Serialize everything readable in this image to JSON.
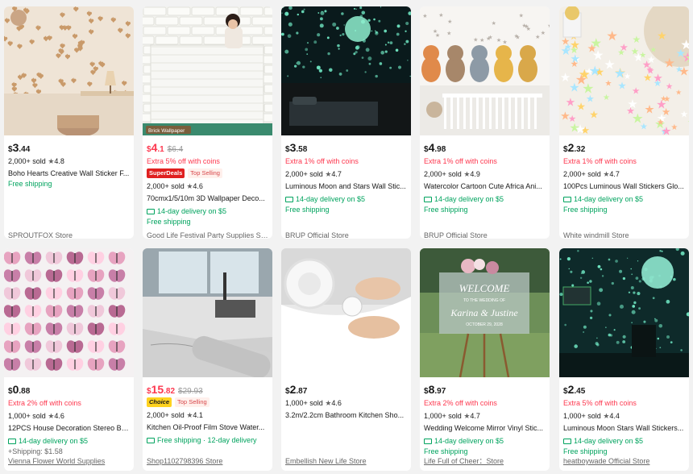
{
  "products": [
    {
      "price_cur": "$",
      "price_int": "3",
      "price_dec": ".44",
      "price_red": false,
      "orig": "",
      "promo": "",
      "badges": [],
      "sold": "2,000+ sold",
      "rating": "4.8",
      "title": "Boho Hearts Creative Wall Sticker F...",
      "delivery": "",
      "shipping": "Free shipping",
      "shipping_extra": "",
      "store": "SPROUTFOX Store",
      "image": "boho-hearts-wall-photo"
    },
    {
      "price_cur": "$",
      "price_int": "4",
      "price_dec": ".1",
      "price_red": true,
      "orig": "$6.4",
      "promo": "Extra 5% off with coins",
      "badges": [
        "SuperDeals",
        "Top Selling"
      ],
      "sold": "2,000+ sold",
      "rating": "4.6",
      "title": "70cmx1/5/10m 3D Wallpaper Deco...",
      "delivery": "14-day delivery on $5",
      "shipping": "Free shipping",
      "shipping_extra": "",
      "store": "Good Life Festival Party Supplies St...",
      "image": "brick-wallpaper-photo",
      "image_label": "Brick Wallpaper"
    },
    {
      "price_cur": "$",
      "price_int": "3",
      "price_dec": ".58",
      "price_red": false,
      "orig": "",
      "promo": "Extra 1% off with coins",
      "badges": [],
      "sold": "2,000+ sold",
      "rating": "4.7",
      "title": "Luminous Moon and Stars Wall Stic...",
      "delivery": "14-day delivery on $5",
      "shipping": "Free shipping",
      "shipping_extra": "",
      "store": "BRUP Official Store",
      "image": "glowing-stars-bedroom-photo"
    },
    {
      "price_cur": "$",
      "price_int": "4",
      "price_dec": ".98",
      "price_red": false,
      "orig": "",
      "promo": "Extra 1% off with coins",
      "badges": [],
      "sold": "2,000+ sold",
      "rating": "4.9",
      "title": "Watercolor Cartoon Cute Africa Ani...",
      "delivery": "14-day delivery on $5",
      "shipping": "Free shipping",
      "shipping_extra": "",
      "store": "BRUP Official Store",
      "image": "animal-nursery-photo"
    },
    {
      "price_cur": "$",
      "price_int": "2",
      "price_dec": ".32",
      "price_red": false,
      "orig": "",
      "promo": "Extra 1% off with coins",
      "badges": [],
      "sold": "2,000+ sold",
      "rating": "4.7",
      "title": "100Pcs Luminous Wall Stickers Glo...",
      "delivery": "14-day delivery on $5",
      "shipping": "Free shipping",
      "shipping_extra": "",
      "store": "White windmill Store",
      "image": "pastel-stars-photo"
    },
    {
      "price_cur": "$",
      "price_int": "0",
      "price_dec": ".88",
      "price_red": false,
      "orig": "",
      "promo": "Extra 2% off with coins",
      "badges": [],
      "sold": "1,000+ sold",
      "rating": "4.6",
      "title": "12PCS House Decoration Stereo Bu...",
      "delivery": "14-day delivery on $5",
      "shipping": "",
      "shipping_extra": "+Shipping: $1.58",
      "store": "Vienna Flower World Supplies",
      "image": "butterflies-photo"
    },
    {
      "price_cur": "$",
      "price_int": "15",
      "price_dec": ".82",
      "price_red": true,
      "orig": "$29.93",
      "promo": "",
      "badges": [
        "Choice",
        "Top Selling"
      ],
      "sold": "2,000+ sold",
      "rating": "4.1",
      "title": "Kitchen Oil-Proof Film Stove Water...",
      "delivery": "Free shipping · 12-day delivery",
      "shipping": "",
      "shipping_extra": "",
      "store": "Shop1102798396 Store",
      "image": "marble-kitchen-photo"
    },
    {
      "price_cur": "$",
      "price_int": "2",
      "price_dec": ".87",
      "price_red": false,
      "orig": "",
      "promo": "",
      "badges": [],
      "sold": "1,000+ sold",
      "rating": "4.6",
      "title": "3.2m/2.2cm Bathroom Kitchen Sho...",
      "delivery": "",
      "shipping": "",
      "shipping_extra": "",
      "store": "Embellish New Life Store",
      "image": "sealing-tape-photo"
    },
    {
      "price_cur": "$",
      "price_int": "8",
      "price_dec": ".97",
      "price_red": false,
      "orig": "",
      "promo": "Extra 2% off with coins",
      "badges": [],
      "sold": "1,000+ sold",
      "rating": "4.7",
      "title": "Wedding Welcome Mirror Vinyl Stic...",
      "delivery": "14-day delivery on $5",
      "shipping": "Free shipping",
      "shipping_extra": "",
      "store": "Life Full of Cheer：Store",
      "image": "wedding-sign-photo",
      "image_lines": [
        "WELCOME",
        "TO THE WEDDING OF",
        "Karina & Justine",
        "OCTOBER 29, 2028"
      ]
    },
    {
      "price_cur": "$",
      "price_int": "2",
      "price_dec": ".45",
      "price_red": false,
      "orig": "",
      "promo": "Extra 5% off with coins",
      "badges": [],
      "sold": "1,000+ sold",
      "rating": "4.4",
      "title": "Luminous Moon Stars Wall Stickers...",
      "delivery": "14-day delivery on $5",
      "shipping": "Free shipping",
      "shipping_extra": "",
      "store": "heatboywade Official Store",
      "image": "glowing-moon-room-photo"
    }
  ]
}
